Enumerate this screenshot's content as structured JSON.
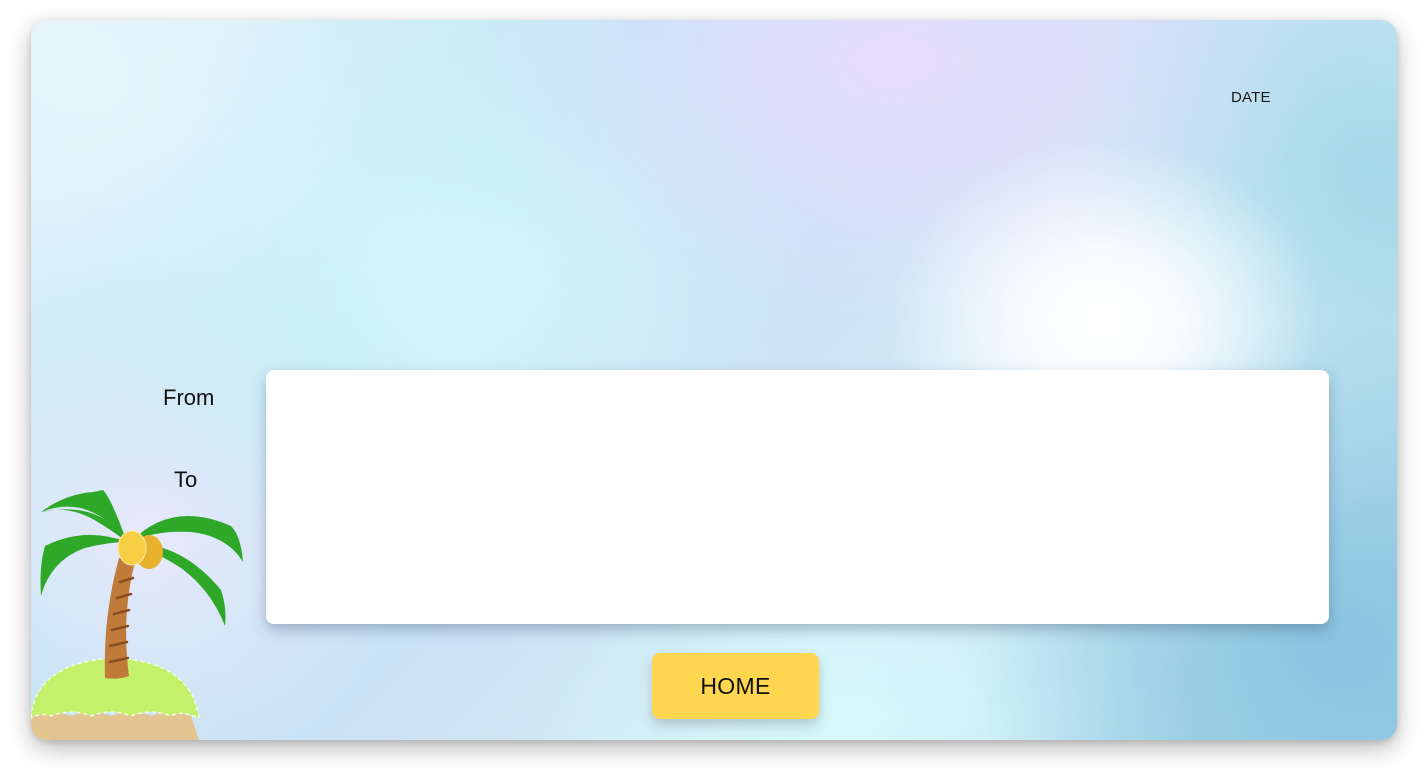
{
  "header": {
    "date_label": "DATE"
  },
  "form": {
    "from_label": "From",
    "to_label": "To",
    "message_value": ""
  },
  "actions": {
    "home_label": "HOME"
  },
  "decor": {
    "illustration": "palm-tree-island-icon"
  },
  "colors": {
    "home_button": "#ffd64f",
    "panel": "#ffffff",
    "palm_leaves": "#2fa82a",
    "island_grass": "#c3f26a",
    "island_sand": "#e4c48e",
    "trunk": "#b8743a",
    "coconut": "#f6c63a"
  }
}
